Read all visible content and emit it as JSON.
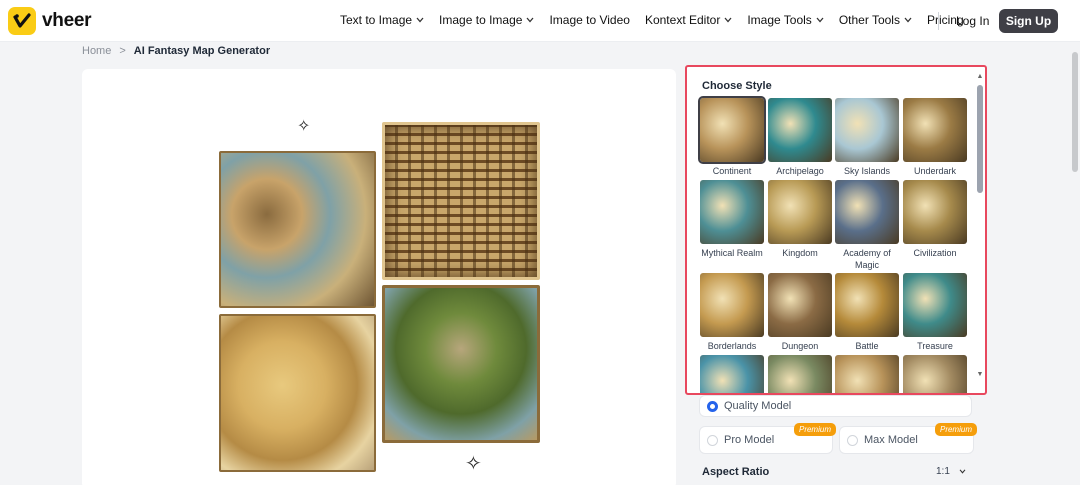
{
  "header": {
    "brand": "vheer",
    "nav": [
      {
        "label": "Text to Image",
        "dropdown": true
      },
      {
        "label": "Image to Image",
        "dropdown": true
      },
      {
        "label": "Image to Video",
        "dropdown": false
      },
      {
        "label": "Kontext Editor",
        "dropdown": true
      },
      {
        "label": "Image Tools",
        "dropdown": true
      },
      {
        "label": "Other Tools",
        "dropdown": true
      },
      {
        "label": "Pricing",
        "dropdown": false
      }
    ],
    "login": "Log In",
    "signup": "Sign Up"
  },
  "breadcrumb": {
    "home": "Home",
    "separator": ">",
    "current": "AI Fantasy Map Generator"
  },
  "style_picker": {
    "title": "Choose Style",
    "selected": "Continent",
    "styles": [
      {
        "label": "Continent",
        "color": "#b8935a"
      },
      {
        "label": "Archipelago",
        "color": "#2f8a8f"
      },
      {
        "label": "Sky Islands",
        "color": "#a9c7d3"
      },
      {
        "label": "Underdark",
        "color": "#9b7b45"
      },
      {
        "label": "Mythical Realm",
        "color": "#4e8f95"
      },
      {
        "label": "Kingdom",
        "color": "#b89a55"
      },
      {
        "label": "Academy of Magic",
        "color": "#5a6f8a"
      },
      {
        "label": "Civilization",
        "color": "#a68a4c"
      },
      {
        "label": "Borderlands",
        "color": "#c49a50"
      },
      {
        "label": "Dungeon",
        "color": "#8b6b45"
      },
      {
        "label": "Battle",
        "color": "#b58a3a"
      },
      {
        "label": "Treasure",
        "color": "#3f8b8a"
      },
      {
        "label": "",
        "color": "#4a93a8"
      },
      {
        "label": "",
        "color": "#7a8a62"
      },
      {
        "label": "",
        "color": "#b8935a"
      },
      {
        "label": "",
        "color": "#a38b62"
      }
    ]
  },
  "model": {
    "options": [
      {
        "label": "Quality Model",
        "selected": true,
        "premium": ""
      },
      {
        "label": "Pro Model",
        "selected": false,
        "premium": "Premium"
      },
      {
        "label": "Max Model",
        "selected": false,
        "premium": "Premium"
      }
    ]
  },
  "aspect_ratio": {
    "label": "Aspect Ratio",
    "value": "1:1"
  }
}
